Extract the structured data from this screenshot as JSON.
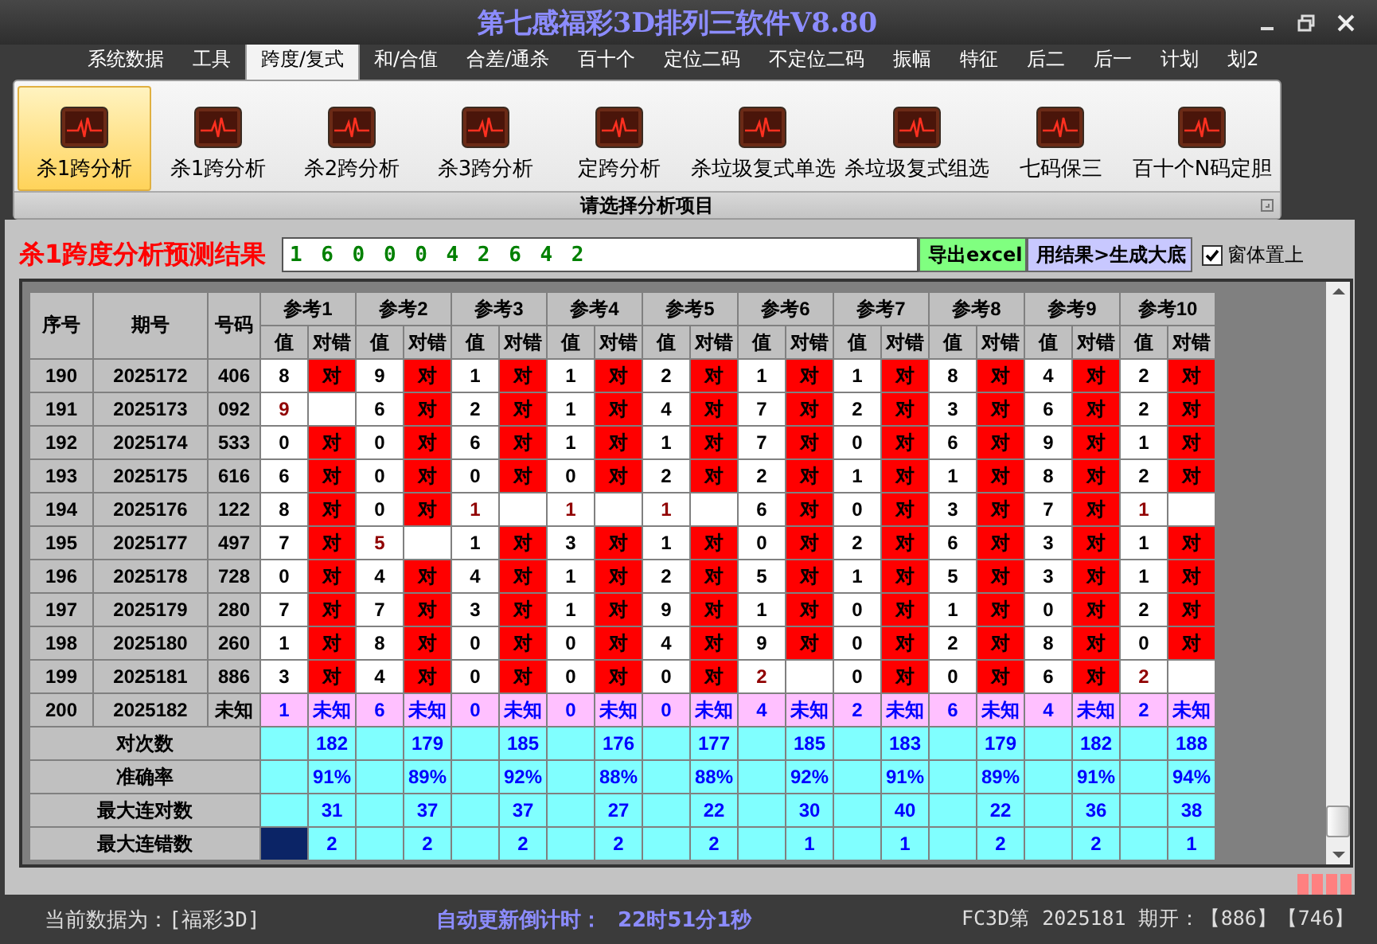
{
  "window": {
    "title": "第七感福彩3D排列三软件V8.80"
  },
  "menu": [
    {
      "label": "系统数据",
      "selected": false
    },
    {
      "label": "工具",
      "selected": false
    },
    {
      "label": "跨度/复式",
      "selected": true
    },
    {
      "label": "和/合值",
      "selected": false
    },
    {
      "label": "合差/通杀",
      "selected": false
    },
    {
      "label": "百十个",
      "selected": false
    },
    {
      "label": "定位二码",
      "selected": false
    },
    {
      "label": "不定位二码",
      "selected": false
    },
    {
      "label": "振幅",
      "selected": false
    },
    {
      "label": "特征",
      "selected": false
    },
    {
      "label": "后二",
      "selected": false
    },
    {
      "label": "后一",
      "selected": false
    },
    {
      "label": "计划",
      "selected": false
    },
    {
      "label": "划2",
      "selected": false
    }
  ],
  "ribbon": {
    "items": [
      {
        "label": "杀1跨分析",
        "selected": true
      },
      {
        "label": "杀1跨分析",
        "selected": false
      },
      {
        "label": "杀2跨分析",
        "selected": false
      },
      {
        "label": "杀3跨分析",
        "selected": false
      },
      {
        "label": "定跨分析",
        "selected": false
      },
      {
        "label": "杀垃圾复式单选",
        "selected": false
      },
      {
        "label": "杀垃圾复式组选",
        "selected": false
      },
      {
        "label": "七码保三",
        "selected": false
      },
      {
        "label": "百十个N码定胆",
        "selected": false
      }
    ],
    "caption": "请选择分析项目"
  },
  "result": {
    "label": "杀1跨度分析预测结果",
    "value": "1 6 0 0 0 4 2 6 4 2",
    "buttons": [
      "导出excel",
      "用结果>生成大底"
    ],
    "pin_on_top": {
      "label": "窗体置上",
      "checked": true
    }
  },
  "table": {
    "headers": [
      "序号",
      "期号",
      "号码"
    ],
    "references": [
      {
        "label": "参考1",
        "value_header": "值",
        "result_header": "对错"
      },
      {
        "label": "参考2",
        "value_header": "值",
        "result_header": "对错"
      },
      {
        "label": "参考3",
        "value_header": "值",
        "result_header": "对错"
      },
      {
        "label": "参考4",
        "value_header": "值",
        "result_header": "对错"
      },
      {
        "label": "参考5",
        "value_header": "值",
        "result_header": "对错"
      },
      {
        "label": "参考6",
        "value_header": "值",
        "result_header": "对错"
      },
      {
        "label": "参考7",
        "value_header": "值",
        "result_header": "对错"
      },
      {
        "label": "参考8",
        "value_header": "值",
        "result_header": "对错"
      },
      {
        "label": "参考9",
        "value_header": "值",
        "result_header": "对错"
      },
      {
        "label": "参考10",
        "value_header": "值",
        "result_header": "对错"
      }
    ],
    "rows": [
      {
        "no": "190",
        "period": "2025172",
        "code": "406",
        "kind": "drawn",
        "cells": [
          {
            "value": "8",
            "correct": true,
            "mark": "对"
          },
          {
            "value": "9",
            "correct": true,
            "mark": "对"
          },
          {
            "value": "1",
            "correct": true,
            "mark": "对"
          },
          {
            "value": "1",
            "correct": true,
            "mark": "对"
          },
          {
            "value": "2",
            "correct": true,
            "mark": "对"
          },
          {
            "value": "1",
            "correct": true,
            "mark": "对"
          },
          {
            "value": "1",
            "correct": true,
            "mark": "对"
          },
          {
            "value": "8",
            "correct": true,
            "mark": "对"
          },
          {
            "value": "4",
            "correct": true,
            "mark": "对"
          },
          {
            "value": "2",
            "correct": true,
            "mark": "对"
          }
        ]
      },
      {
        "no": "191",
        "period": "2025173",
        "code": "092",
        "kind": "drawn",
        "cells": [
          {
            "value": "9",
            "correct": false
          },
          {
            "value": "6",
            "correct": true,
            "mark": "对"
          },
          {
            "value": "2",
            "correct": true,
            "mark": "对"
          },
          {
            "value": "1",
            "correct": true,
            "mark": "对"
          },
          {
            "value": "4",
            "correct": true,
            "mark": "对"
          },
          {
            "value": "7",
            "correct": true,
            "mark": "对"
          },
          {
            "value": "2",
            "correct": true,
            "mark": "对"
          },
          {
            "value": "3",
            "correct": true,
            "mark": "对"
          },
          {
            "value": "6",
            "correct": true,
            "mark": "对"
          },
          {
            "value": "2",
            "correct": true,
            "mark": "对"
          }
        ]
      },
      {
        "no": "192",
        "period": "2025174",
        "code": "533",
        "kind": "drawn",
        "cells": [
          {
            "value": "0",
            "correct": true,
            "mark": "对"
          },
          {
            "value": "0",
            "correct": true,
            "mark": "对"
          },
          {
            "value": "6",
            "correct": true,
            "mark": "对"
          },
          {
            "value": "1",
            "correct": true,
            "mark": "对"
          },
          {
            "value": "1",
            "correct": true,
            "mark": "对"
          },
          {
            "value": "7",
            "correct": true,
            "mark": "对"
          },
          {
            "value": "0",
            "correct": true,
            "mark": "对"
          },
          {
            "value": "6",
            "correct": true,
            "mark": "对"
          },
          {
            "value": "9",
            "correct": true,
            "mark": "对"
          },
          {
            "value": "1",
            "correct": true,
            "mark": "对"
          }
        ]
      },
      {
        "no": "193",
        "period": "2025175",
        "code": "616",
        "kind": "drawn",
        "cells": [
          {
            "value": "6",
            "correct": true,
            "mark": "对"
          },
          {
            "value": "0",
            "correct": true,
            "mark": "对"
          },
          {
            "value": "0",
            "correct": true,
            "mark": "对"
          },
          {
            "value": "0",
            "correct": true,
            "mark": "对"
          },
          {
            "value": "2",
            "correct": true,
            "mark": "对"
          },
          {
            "value": "2",
            "correct": true,
            "mark": "对"
          },
          {
            "value": "1",
            "correct": true,
            "mark": "对"
          },
          {
            "value": "1",
            "correct": true,
            "mark": "对"
          },
          {
            "value": "8",
            "correct": true,
            "mark": "对"
          },
          {
            "value": "2",
            "correct": true,
            "mark": "对"
          }
        ]
      },
      {
        "no": "194",
        "period": "2025176",
        "code": "122",
        "kind": "drawn",
        "cells": [
          {
            "value": "8",
            "correct": true,
            "mark": "对"
          },
          {
            "value": "0",
            "correct": true,
            "mark": "对"
          },
          {
            "value": "1",
            "correct": false
          },
          {
            "value": "1",
            "correct": false
          },
          {
            "value": "1",
            "correct": false
          },
          {
            "value": "6",
            "correct": true,
            "mark": "对"
          },
          {
            "value": "0",
            "correct": true,
            "mark": "对"
          },
          {
            "value": "3",
            "correct": true,
            "mark": "对"
          },
          {
            "value": "7",
            "correct": true,
            "mark": "对"
          },
          {
            "value": "1",
            "correct": false
          }
        ]
      },
      {
        "no": "195",
        "period": "2025177",
        "code": "497",
        "kind": "drawn",
        "cells": [
          {
            "value": "7",
            "correct": true,
            "mark": "对"
          },
          {
            "value": "5",
            "correct": false
          },
          {
            "value": "1",
            "correct": true,
            "mark": "对"
          },
          {
            "value": "3",
            "correct": true,
            "mark": "对"
          },
          {
            "value": "1",
            "correct": true,
            "mark": "对"
          },
          {
            "value": "0",
            "correct": true,
            "mark": "对"
          },
          {
            "value": "2",
            "correct": true,
            "mark": "对"
          },
          {
            "value": "6",
            "correct": true,
            "mark": "对"
          },
          {
            "value": "3",
            "correct": true,
            "mark": "对"
          },
          {
            "value": "1",
            "correct": true,
            "mark": "对"
          }
        ]
      },
      {
        "no": "196",
        "period": "2025178",
        "code": "728",
        "kind": "drawn",
        "cells": [
          {
            "value": "0",
            "correct": true,
            "mark": "对"
          },
          {
            "value": "4",
            "correct": true,
            "mark": "对"
          },
          {
            "value": "4",
            "correct": true,
            "mark": "对"
          },
          {
            "value": "1",
            "correct": true,
            "mark": "对"
          },
          {
            "value": "2",
            "correct": true,
            "mark": "对"
          },
          {
            "value": "5",
            "correct": true,
            "mark": "对"
          },
          {
            "value": "1",
            "correct": true,
            "mark": "对"
          },
          {
            "value": "5",
            "correct": true,
            "mark": "对"
          },
          {
            "value": "3",
            "correct": true,
            "mark": "对"
          },
          {
            "value": "1",
            "correct": true,
            "mark": "对"
          }
        ]
      },
      {
        "no": "197",
        "period": "2025179",
        "code": "280",
        "kind": "drawn",
        "cells": [
          {
            "value": "7",
            "correct": true,
            "mark": "对"
          },
          {
            "value": "7",
            "correct": true,
            "mark": "对"
          },
          {
            "value": "3",
            "correct": true,
            "mark": "对"
          },
          {
            "value": "1",
            "correct": true,
            "mark": "对"
          },
          {
            "value": "9",
            "correct": true,
            "mark": "对"
          },
          {
            "value": "1",
            "correct": true,
            "mark": "对"
          },
          {
            "value": "0",
            "correct": true,
            "mark": "对"
          },
          {
            "value": "1",
            "correct": true,
            "mark": "对"
          },
          {
            "value": "0",
            "correct": true,
            "mark": "对"
          },
          {
            "value": "2",
            "correct": true,
            "mark": "对"
          }
        ]
      },
      {
        "no": "198",
        "period": "2025180",
        "code": "260",
        "kind": "drawn",
        "cells": [
          {
            "value": "1",
            "correct": true,
            "mark": "对"
          },
          {
            "value": "8",
            "correct": true,
            "mark": "对"
          },
          {
            "value": "0",
            "correct": true,
            "mark": "对"
          },
          {
            "value": "0",
            "correct": true,
            "mark": "对"
          },
          {
            "value": "4",
            "correct": true,
            "mark": "对"
          },
          {
            "value": "9",
            "correct": true,
            "mark": "对"
          },
          {
            "value": "0",
            "correct": true,
            "mark": "对"
          },
          {
            "value": "2",
            "correct": true,
            "mark": "对"
          },
          {
            "value": "8",
            "correct": true,
            "mark": "对"
          },
          {
            "value": "0",
            "correct": true,
            "mark": "对"
          }
        ]
      },
      {
        "no": "199",
        "period": "2025181",
        "code": "886",
        "kind": "drawn",
        "cells": [
          {
            "value": "3",
            "correct": true,
            "mark": "对"
          },
          {
            "value": "4",
            "correct": true,
            "mark": "对"
          },
          {
            "value": "0",
            "correct": true,
            "mark": "对"
          },
          {
            "value": "0",
            "correct": true,
            "mark": "对"
          },
          {
            "value": "0",
            "correct": true,
            "mark": "对"
          },
          {
            "value": "2",
            "correct": false
          },
          {
            "value": "0",
            "correct": true,
            "mark": "对"
          },
          {
            "value": "0",
            "correct": true,
            "mark": "对"
          },
          {
            "value": "6",
            "correct": true,
            "mark": "对"
          },
          {
            "value": "2",
            "correct": false
          }
        ]
      },
      {
        "no": "200",
        "period": "2025182",
        "code": "未知",
        "kind": "pending",
        "cells": [
          {
            "value": "1",
            "mark": "未知"
          },
          {
            "value": "6",
            "mark": "未知"
          },
          {
            "value": "0",
            "mark": "未知"
          },
          {
            "value": "0",
            "mark": "未知"
          },
          {
            "value": "0",
            "mark": "未知"
          },
          {
            "value": "4",
            "mark": "未知"
          },
          {
            "value": "2",
            "mark": "未知"
          },
          {
            "value": "6",
            "mark": "未知"
          },
          {
            "value": "4",
            "mark": "未知"
          },
          {
            "value": "2",
            "mark": "未知"
          }
        ]
      }
    ],
    "stats": [
      {
        "label": "对次数",
        "first_cell_selected": false,
        "values": [
          "182",
          "179",
          "185",
          "176",
          "177",
          "185",
          "183",
          "179",
          "182",
          "188"
        ]
      },
      {
        "label": "准确率",
        "first_cell_selected": false,
        "values": [
          "91%",
          "89%",
          "92%",
          "88%",
          "88%",
          "92%",
          "91%",
          "89%",
          "91%",
          "94%"
        ]
      },
      {
        "label": "最大连对数",
        "first_cell_selected": false,
        "values": [
          "31",
          "37",
          "37",
          "27",
          "22",
          "30",
          "40",
          "22",
          "36",
          "38"
        ]
      },
      {
        "label": "最大连错数",
        "first_cell_selected": true,
        "values": [
          "2",
          "2",
          "2",
          "2",
          "2",
          "1",
          "1",
          "2",
          "2",
          "1"
        ]
      }
    ]
  },
  "status_bar": {
    "data_source": "当前数据为：[福彩3D]",
    "countdown_label": "自动更新倒计时：",
    "countdown": "22时51分1秒",
    "last_draw": "FC3D第 2025181 期开：【886】【746】"
  }
}
